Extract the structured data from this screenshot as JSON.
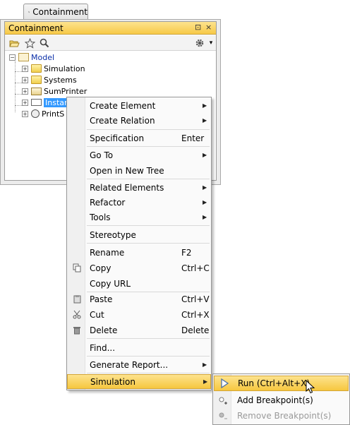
{
  "tab": {
    "label": "Containment"
  },
  "panel": {
    "title": "Containment",
    "controls": {
      "restore": "⊡",
      "close": "×"
    }
  },
  "toolbar": {
    "icons": [
      "open-folder-icon",
      "star-icon",
      "search-icon",
      "gear-icon"
    ],
    "dropdown_glyph": "▾"
  },
  "tree": {
    "root": {
      "label": "Model",
      "expander": "−"
    },
    "items": [
      {
        "label": "Simulation",
        "expander": "+",
        "icon": "folder-icon"
      },
      {
        "label": "Systems",
        "expander": "+",
        "icon": "folder-icon"
      },
      {
        "label": "SumPrinter",
        "expander": "+",
        "icon": "class-icon"
      },
      {
        "label": "Instar",
        "expander": "+",
        "icon": "instance-icon",
        "selected": true
      },
      {
        "label": "PrintS",
        "expander": "+",
        "icon": "gear-node-icon"
      }
    ]
  },
  "context_menu": {
    "items": [
      {
        "label": "Create Element",
        "shortcut": "",
        "submenu": true
      },
      {
        "label": "Create Relation",
        "shortcut": "",
        "submenu": true
      },
      {
        "label": "Specification",
        "shortcut": "Enter",
        "submenu": false
      },
      {
        "label": "Go To",
        "shortcut": "",
        "submenu": true
      },
      {
        "label": "Open in New Tree",
        "shortcut": "",
        "submenu": false
      },
      {
        "label": "Related Elements",
        "shortcut": "",
        "submenu": true
      },
      {
        "label": "Refactor",
        "shortcut": "",
        "submenu": true
      },
      {
        "label": "Tools",
        "shortcut": "",
        "submenu": true
      },
      {
        "label": "Stereotype",
        "shortcut": "",
        "submenu": false
      },
      {
        "label": "Rename",
        "shortcut": "F2",
        "submenu": false
      },
      {
        "label": "Copy",
        "shortcut": "Ctrl+C",
        "submenu": false,
        "icon": "copy-icon"
      },
      {
        "label": "Copy URL",
        "shortcut": "",
        "submenu": false
      },
      {
        "label": "Paste",
        "shortcut": "Ctrl+V",
        "submenu": false,
        "icon": "paste-icon"
      },
      {
        "label": "Cut",
        "shortcut": "Ctrl+X",
        "submenu": false,
        "icon": "scissors-icon"
      },
      {
        "label": "Delete",
        "shortcut": "Delete",
        "submenu": false,
        "icon": "trash-icon"
      },
      {
        "label": "Find...",
        "shortcut": "",
        "submenu": false
      },
      {
        "label": "Generate Report...",
        "shortcut": "",
        "submenu": true
      },
      {
        "label": "Simulation",
        "shortcut": "",
        "submenu": true,
        "highlighted": true
      }
    ],
    "submenu_arrow": "▶"
  },
  "simulation_submenu": {
    "items": [
      {
        "label": "Run (Ctrl+Alt+X)",
        "icon": "play-icon",
        "highlighted": true,
        "enabled": true
      },
      {
        "label": "Add Breakpoint(s)",
        "icon": "add-breakpoint-icon",
        "enabled": true
      },
      {
        "label": "Remove Breakpoint(s)",
        "icon": "remove-breakpoint-icon",
        "enabled": false
      }
    ]
  },
  "colors": {
    "highlight": "#f6c73f",
    "selection": "#3399ff",
    "title_bar": "#f7c948"
  }
}
